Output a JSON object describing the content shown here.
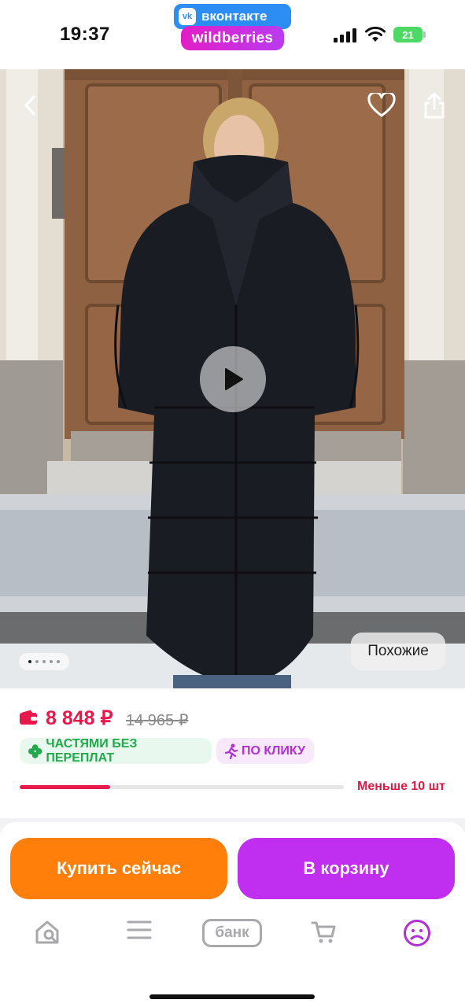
{
  "status_bar": {
    "time": "19:37",
    "vk_label": "вконтакте",
    "vk_logo_text": "vk",
    "app_badge": "wildberries",
    "battery_level": "21"
  },
  "gallery": {
    "similar_label": "Похожие",
    "image_count": 5,
    "active_image_index": 0,
    "icons": [
      "back-icon",
      "heart-icon",
      "share-icon",
      "play-icon"
    ]
  },
  "product": {
    "price": "8 848 ₽",
    "old_price": "14 965 ₽",
    "installment_chip": "ЧАСТЯМИ БЕЗ ПЕРЕПЛАТ",
    "click_chip": "ПО КЛИКУ",
    "stock_label": "Меньше 10 шт",
    "stock_level": 0.28,
    "colors": {
      "price": "#e8184d",
      "installment": "#21a94b",
      "click": "#b22fd3"
    }
  },
  "actions": {
    "buy_now": "Купить сейчас",
    "to_cart": "В корзину",
    "buy_color": "#ff7f0a",
    "cart_color": "#c02ef0"
  },
  "tabbar": {
    "bank_label": "банк",
    "tabs": [
      "home-search-icon",
      "menu-icon",
      "bank-tab",
      "cart-icon",
      "profile-icon"
    ],
    "active_color": "#b22fd3"
  }
}
